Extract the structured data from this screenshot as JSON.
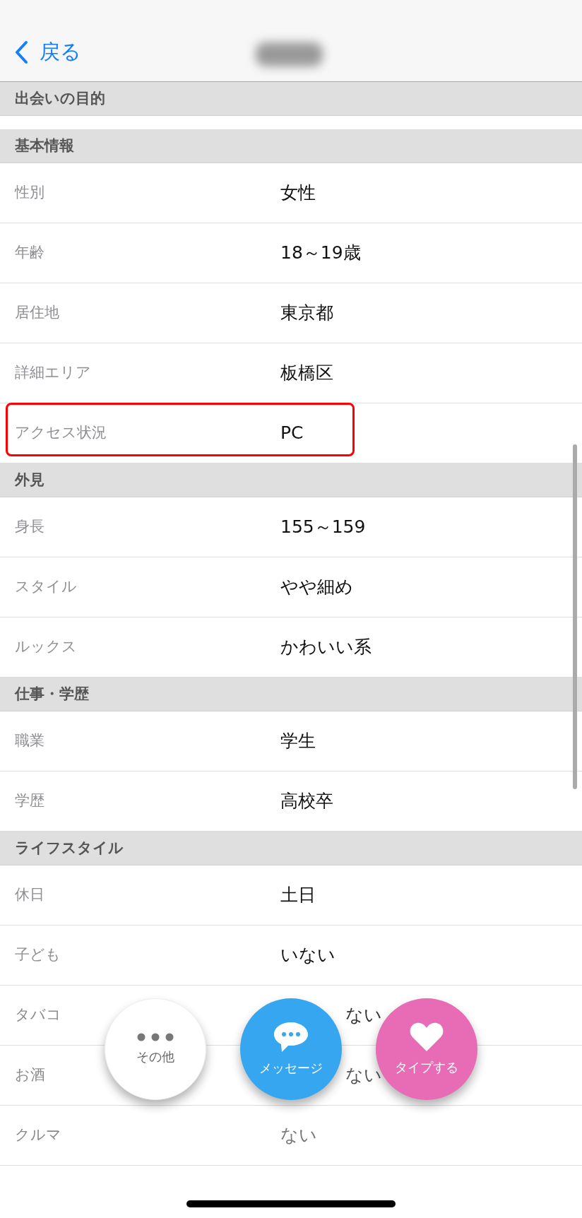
{
  "nav": {
    "back_label": "戻る"
  },
  "sections": [
    {
      "title": "出会いの目的"
    },
    {
      "title": "基本情報",
      "rows": [
        {
          "label": "性別",
          "value": "女性",
          "highlighted": false,
          "kind": "field"
        },
        {
          "label": "年齢",
          "value": "18～19歳",
          "highlighted": false,
          "kind": "field"
        },
        {
          "label": "居住地",
          "value": "東京都",
          "highlighted": false,
          "kind": "field"
        },
        {
          "label": "詳細エリア",
          "value": "板橋区",
          "highlighted": false,
          "kind": "field"
        },
        {
          "label": "アクセス状況",
          "value": "PC",
          "highlighted": true,
          "kind": "field"
        }
      ]
    },
    {
      "title": "外見",
      "rows": [
        {
          "label": "身長",
          "value": "155～159",
          "highlighted": false,
          "kind": "field"
        },
        {
          "label": "スタイル",
          "value": "やや細め",
          "highlighted": false,
          "kind": "field"
        },
        {
          "label": "ルックス",
          "value": "かわいい系",
          "highlighted": false,
          "kind": "field"
        }
      ]
    },
    {
      "title": "仕事・学歴",
      "rows": [
        {
          "label": "職業",
          "value": "学生",
          "highlighted": false,
          "kind": "field"
        },
        {
          "label": "学歴",
          "value": "高校卒",
          "highlighted": false,
          "kind": "field"
        }
      ]
    },
    {
      "title": "ライフスタイル",
      "rows": [
        {
          "label": "休日",
          "value": "土日",
          "highlighted": false,
          "kind": "field"
        },
        {
          "label": "子ども",
          "value": "いない",
          "highlighted": false,
          "kind": "field"
        },
        {
          "label": "タバコ",
          "value": "ない",
          "highlighted": false,
          "kind": "covered"
        },
        {
          "label": "お酒",
          "value": "ない",
          "highlighted": false,
          "kind": "covered"
        },
        {
          "label": "クルマ",
          "value": "ない",
          "highlighted": false,
          "kind": "field"
        }
      ]
    }
  ],
  "actions": [
    {
      "label": "その他",
      "kind": "more"
    },
    {
      "label": "メッセージ",
      "kind": "message"
    },
    {
      "label": "タイプする",
      "kind": "like"
    }
  ]
}
